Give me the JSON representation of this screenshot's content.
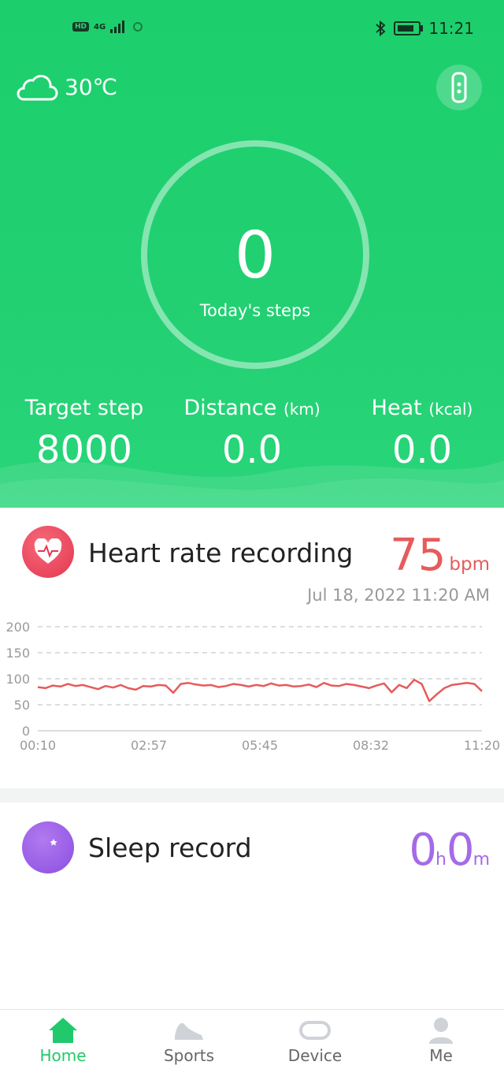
{
  "status": {
    "hd": "HD",
    "net": "4G",
    "time": "11:21"
  },
  "weather": {
    "temp": "30℃"
  },
  "steps": {
    "value": "0",
    "label": "Today's steps"
  },
  "stats": [
    {
      "label": "Target step",
      "unit": "",
      "value": "8000"
    },
    {
      "label": "Distance",
      "unit": "(km)",
      "value": "0.0"
    },
    {
      "label": "Heat",
      "unit": "(kcal)",
      "value": "0.0"
    }
  ],
  "heart": {
    "title": "Heart rate recording",
    "value": "75",
    "unit": "bpm",
    "date": "Jul 18, 2022 11:20 AM"
  },
  "chart_data": {
    "type": "line",
    "y_ticks": [
      "200",
      "150",
      "100",
      "50",
      "0"
    ],
    "x_ticks": [
      "00:10",
      "02:57",
      "05:45",
      "08:32",
      "11:20"
    ],
    "ylim": [
      0,
      200
    ],
    "series": [
      {
        "values": [
          84,
          82,
          87,
          85,
          90,
          86,
          88,
          84,
          80,
          86,
          83,
          88,
          82,
          79,
          86,
          85,
          88,
          87,
          73,
          90,
          92,
          89,
          87,
          88,
          84,
          86,
          90,
          88,
          85,
          88,
          86,
          91,
          87,
          88,
          85,
          86,
          89,
          84,
          92,
          87,
          86,
          90,
          88,
          85,
          82,
          87,
          91,
          74,
          88,
          82,
          98,
          90,
          57,
          70,
          82,
          88,
          90,
          92,
          90,
          76
        ]
      }
    ],
    "color": "#e65b5b"
  },
  "sleep": {
    "title": "Sleep record",
    "hours": "0",
    "h": "h",
    "minutes": "0",
    "m": "m"
  },
  "nav": [
    {
      "label": "Home",
      "icon": "home-icon",
      "active": true
    },
    {
      "label": "Sports",
      "icon": "shoe-icon",
      "active": false
    },
    {
      "label": "Device",
      "icon": "band-icon",
      "active": false
    },
    {
      "label": "Me",
      "icon": "person-icon",
      "active": false
    }
  ]
}
